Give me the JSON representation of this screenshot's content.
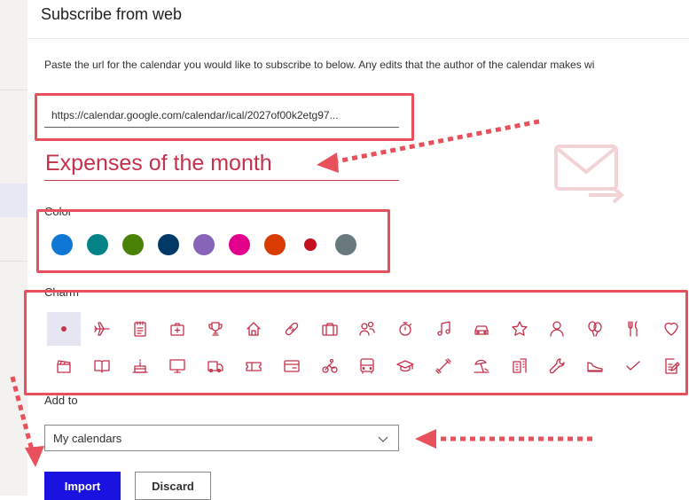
{
  "panel": {
    "title": "Subscribe from web",
    "description": "Paste the url for the calendar you would like to subscribe to below. Any edits that the author of the calendar makes wi"
  },
  "url_field": {
    "value": "https://calendar.google.com/calendar/ical/2027of00k2etg97..."
  },
  "name_field": {
    "value": "Expenses of the month"
  },
  "color": {
    "label": "Color",
    "options": [
      {
        "name": "blue",
        "hex": "#0f78d4"
      },
      {
        "name": "teal",
        "hex": "#038387"
      },
      {
        "name": "green",
        "hex": "#498205"
      },
      {
        "name": "dark-blue",
        "hex": "#003966"
      },
      {
        "name": "purple",
        "hex": "#8764b8"
      },
      {
        "name": "magenta",
        "hex": "#e3008c"
      },
      {
        "name": "orange",
        "hex": "#da3b01"
      },
      {
        "name": "red",
        "hex": "#c50f1f",
        "selected": true
      },
      {
        "name": "gray",
        "hex": "#69797e"
      }
    ]
  },
  "charm": {
    "label": "Charm",
    "icon_color": "#c4314b",
    "row1": [
      "dot-icon",
      "airplane-icon",
      "notepad-icon",
      "medical-kit-icon",
      "trophy-icon",
      "home-icon",
      "bandage-icon",
      "briefcase-icon",
      "people-icon",
      "stopwatch-icon",
      "music-note-icon",
      "car-icon",
      "star-icon",
      "person-icon",
      "balloons-icon",
      "fork-knife-icon",
      "heart-icon"
    ],
    "row2": [
      "clapperboard-icon",
      "book-icon",
      "birthday-cake-icon",
      "monitor-icon",
      "truck-icon",
      "ticket-icon",
      "credit-card-icon",
      "cyclist-icon",
      "bus-icon",
      "graduation-cap-icon",
      "dumbbell-icon",
      "beach-icon",
      "building-icon",
      "wrench-icon",
      "sneaker-icon",
      "checkmark-icon",
      "edit-document-icon"
    ]
  },
  "add_to": {
    "label": "Add to",
    "selected": "My calendars"
  },
  "buttons": {
    "import": "Import",
    "discard": "Discard"
  },
  "annotation_color": "#e8505b",
  "primary_color": "#1a12e0"
}
